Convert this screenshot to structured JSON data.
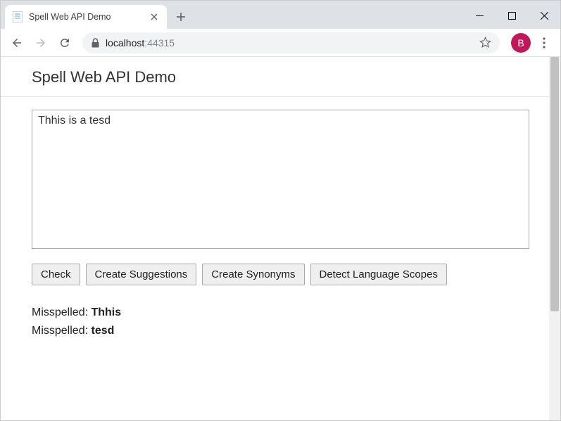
{
  "window": {
    "tab_title": "Spell Web API Demo",
    "url_host": "localhost",
    "url_port": ":44315",
    "avatar_initial": "B"
  },
  "page": {
    "title": "Spell Web API Demo",
    "textarea_value": "Thhis is a tesd",
    "buttons": {
      "check": "Check",
      "create_suggestions": "Create Suggestions",
      "create_synonyms": "Create Synonyms",
      "detect_language_scopes": "Detect Language Scopes"
    },
    "results": [
      {
        "label": "Misspelled: ",
        "word": "Thhis"
      },
      {
        "label": "Misspelled: ",
        "word": "tesd"
      }
    ]
  }
}
